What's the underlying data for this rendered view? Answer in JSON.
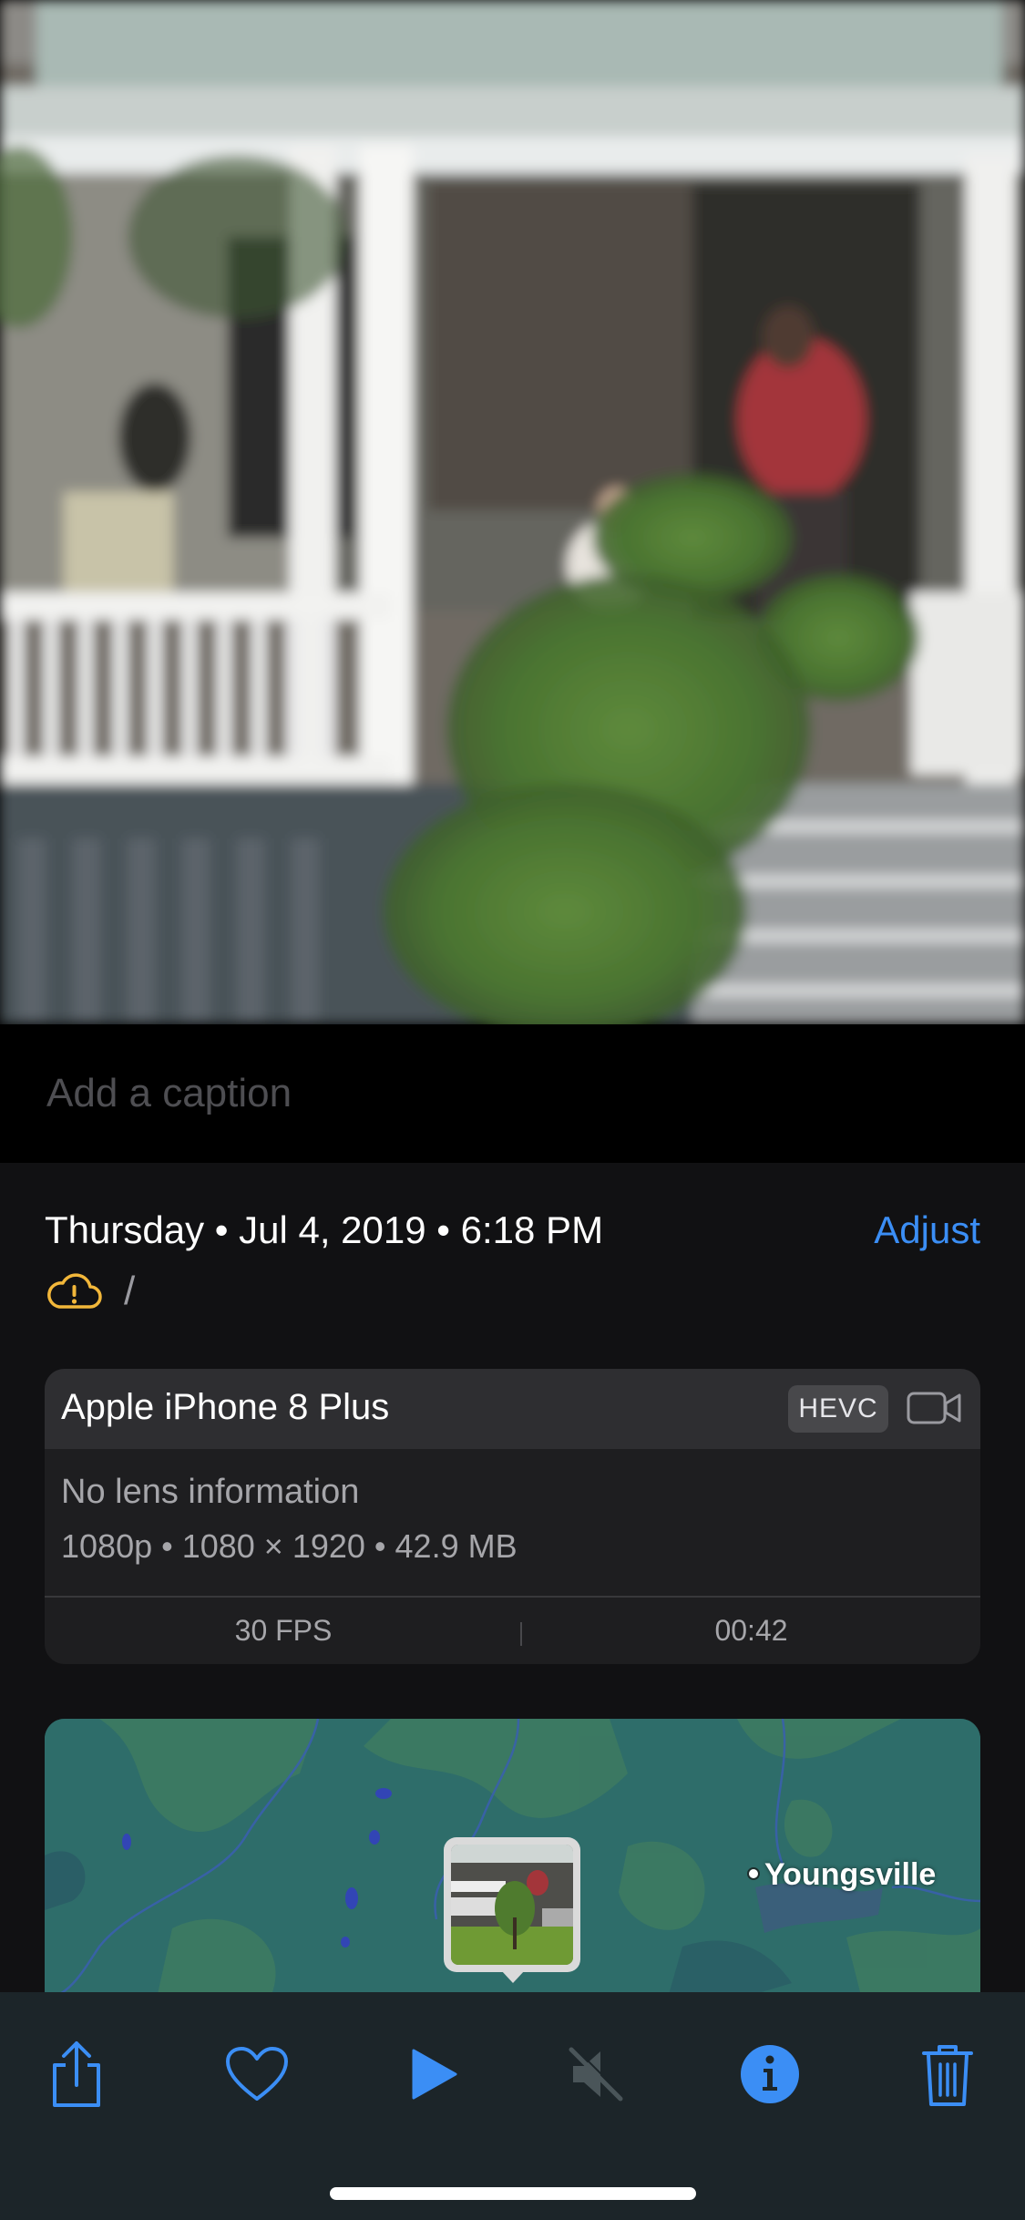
{
  "photo": {
    "subject": "porch-photo"
  },
  "caption": {
    "placeholder": "Add a caption",
    "value": ""
  },
  "info": {
    "date_line": "Thursday • Jul 4, 2019 • 6:18 PM",
    "adjust_label": "Adjust",
    "location_text": "/",
    "status_icon": "cloud-warning-icon",
    "status_color": "#f2b73a"
  },
  "camera": {
    "device": "Apple iPhone 8 Plus",
    "format": "HEVC",
    "lens": "No lens information",
    "specs": "1080p  •  1080 × 1920  •  42.9 MB",
    "fps": "30 FPS",
    "duration": "00:42"
  },
  "map": {
    "place_label": "Youngsville"
  },
  "toolbar": {
    "items": [
      {
        "name": "share-icon"
      },
      {
        "name": "heart-icon"
      },
      {
        "name": "play-icon"
      },
      {
        "name": "mute-icon"
      },
      {
        "name": "info-icon"
      },
      {
        "name": "trash-icon"
      }
    ],
    "accent": "#3b8ef5"
  }
}
